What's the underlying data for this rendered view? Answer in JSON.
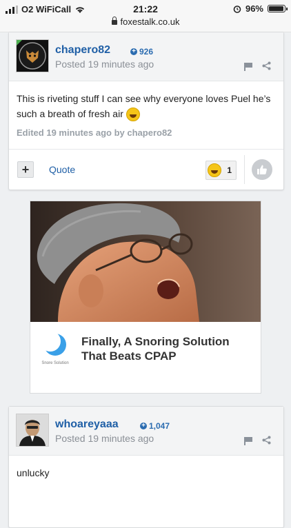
{
  "status_bar": {
    "carrier": "O2 WiFiCall",
    "time": "21:22",
    "url": "foxestalk.co.uk",
    "battery": "96%",
    "battery_level": 0.96
  },
  "posts": [
    {
      "author": "chapero82",
      "reputation": "926",
      "posted": "Posted 19 minutes ago",
      "body": "This is riveting stuff I can see why everyone loves Puel he’s such a breath of fresh air",
      "edited": "Edited 19 minutes ago by chapero82",
      "quote_label": "Quote",
      "reaction_count": "1",
      "plus_label": "+"
    },
    {
      "author": "whoareyaaa",
      "reputation": "1,047",
      "posted": "Posted 19 minutes ago",
      "body": "unlucky"
    }
  ],
  "ad": {
    "title": "Finally, A Snoring Solution That Beats CPAP",
    "brand": "Snore Solution"
  },
  "icons": {
    "rep": "plus-circle-icon",
    "report": "flag-icon",
    "share": "share-icon",
    "like": "thumbs-up-icon",
    "reaction": "laughing-emoji-icon"
  },
  "colors": {
    "link": "#1f5fa6",
    "muted": "#8a8f96"
  }
}
